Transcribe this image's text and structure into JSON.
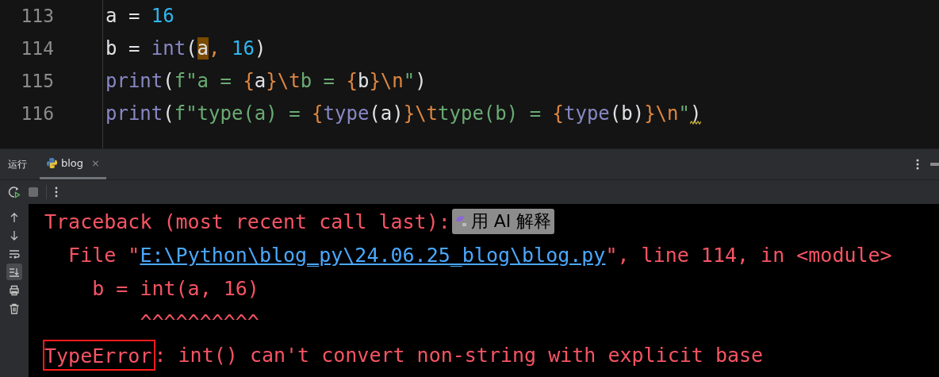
{
  "editor": {
    "lines": [
      {
        "number": "113",
        "warning": false,
        "tokens": [
          {
            "text": "a = ",
            "kind": "plain",
            "highlighted": false
          },
          {
            "text": "16",
            "kind": "number",
            "highlighted": false
          }
        ]
      },
      {
        "number": "114",
        "warning": false,
        "tokens": [
          {
            "text": "b = ",
            "kind": "plain",
            "highlighted": false
          },
          {
            "text": "int",
            "kind": "builtin",
            "highlighted": false
          },
          {
            "text": "(",
            "kind": "plain",
            "highlighted": false
          },
          {
            "text": "a",
            "kind": "plain",
            "highlighted": true
          },
          {
            "text": ", ",
            "kind": "brace",
            "highlighted": false
          },
          {
            "text": "16",
            "kind": "number",
            "highlighted": false
          },
          {
            "text": ")",
            "kind": "plain",
            "highlighted": false
          }
        ]
      },
      {
        "number": "115",
        "warning": false,
        "tokens": [
          {
            "text": "print",
            "kind": "builtin",
            "highlighted": false
          },
          {
            "text": "(",
            "kind": "plain",
            "highlighted": false
          },
          {
            "text": "f\"a = ",
            "kind": "string",
            "highlighted": false
          },
          {
            "text": "{",
            "kind": "brace",
            "highlighted": false
          },
          {
            "text": "a",
            "kind": "plain",
            "highlighted": false
          },
          {
            "text": "}\\t",
            "kind": "brace",
            "highlighted": false
          },
          {
            "text": "b = ",
            "kind": "string",
            "highlighted": false
          },
          {
            "text": "{",
            "kind": "brace",
            "highlighted": false
          },
          {
            "text": "b",
            "kind": "plain",
            "highlighted": false
          },
          {
            "text": "}\\n",
            "kind": "brace",
            "highlighted": false
          },
          {
            "text": "\"",
            "kind": "string",
            "highlighted": false
          },
          {
            "text": ")",
            "kind": "plain",
            "highlighted": false
          }
        ]
      },
      {
        "number": "116",
        "warning": true,
        "tokens": [
          {
            "text": "print",
            "kind": "builtin",
            "highlighted": false
          },
          {
            "text": "(",
            "kind": "plain",
            "highlighted": false
          },
          {
            "text": "f\"type(a) = ",
            "kind": "string",
            "highlighted": false
          },
          {
            "text": "{",
            "kind": "brace",
            "highlighted": false
          },
          {
            "text": "type",
            "kind": "builtin",
            "highlighted": false
          },
          {
            "text": "(a)",
            "kind": "plain",
            "highlighted": false
          },
          {
            "text": "}\\t",
            "kind": "brace",
            "highlighted": false
          },
          {
            "text": "type(b) = ",
            "kind": "string",
            "highlighted": false
          },
          {
            "text": "{",
            "kind": "brace",
            "highlighted": false
          },
          {
            "text": "type",
            "kind": "builtin",
            "highlighted": false
          },
          {
            "text": "(b)",
            "kind": "plain",
            "highlighted": false
          },
          {
            "text": "}\\n",
            "kind": "brace",
            "highlighted": false
          },
          {
            "text": "\"",
            "kind": "string",
            "highlighted": false
          },
          {
            "text": ")",
            "kind": "plain",
            "highlighted": false
          }
        ]
      }
    ]
  },
  "run_panel": {
    "label": "运行",
    "tabs": [
      {
        "label": "blog",
        "close": "×",
        "selected": true
      }
    ],
    "toolbar": {
      "stop_disabled": true
    },
    "sidebar": [
      {
        "kind": "up",
        "selected": false
      },
      {
        "kind": "down",
        "selected": false
      },
      {
        "kind": "wrap",
        "selected": false
      },
      {
        "kind": "scroll-end",
        "selected": true
      },
      {
        "kind": "print",
        "selected": false
      },
      {
        "kind": "trash",
        "selected": false
      }
    ],
    "console": {
      "lines": [
        {
          "segments": [
            {
              "text": "Traceback (most recent call last):",
              "kind": "text"
            },
            {
              "text": "用 AI 解释",
              "kind": "ai-button"
            }
          ]
        },
        {
          "segments": [
            {
              "text": "  File \"",
              "kind": "text"
            },
            {
              "text": "E:\\Python\\blog_py\\24.06.25_blog\\blog.py",
              "kind": "link"
            },
            {
              "text": "\", line 114, in <module>",
              "kind": "text"
            }
          ]
        },
        {
          "segments": [
            {
              "text": "    b = int(a, 16)",
              "kind": "text"
            }
          ]
        },
        {
          "segments": [
            {
              "text": "        ^^^^^^^^^^",
              "kind": "text"
            }
          ]
        },
        {
          "segments": [
            {
              "text": "TypeError",
              "kind": "boxed"
            },
            {
              "text": ": int() can't convert non-string with explicit base",
              "kind": "text"
            }
          ]
        }
      ]
    }
  }
}
